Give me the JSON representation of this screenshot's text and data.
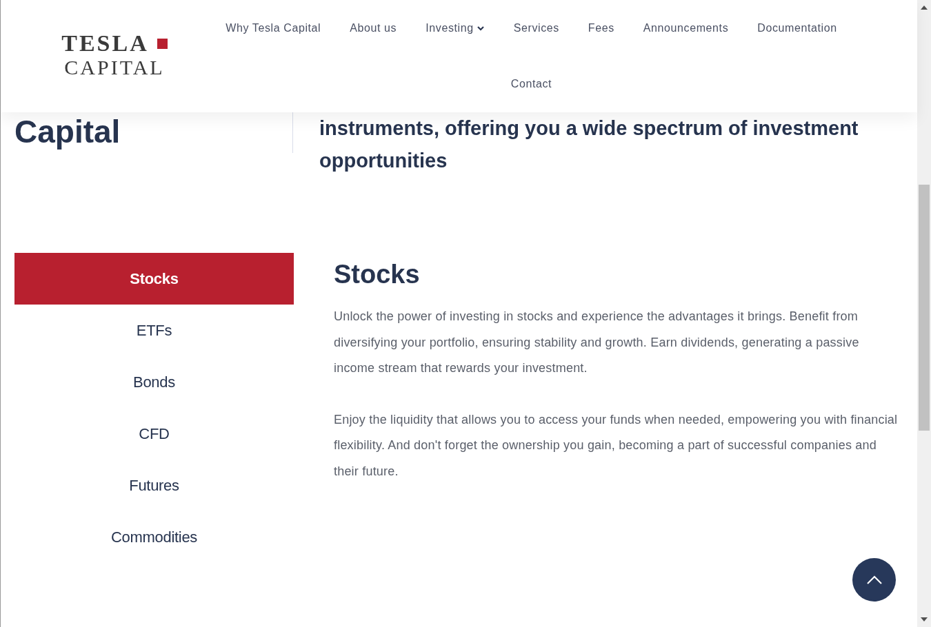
{
  "header": {
    "logo": {
      "line_1": "TESLA",
      "line_2": "CAPITAL"
    },
    "nav": [
      {
        "label": "Why Tesla Capital",
        "dropdown": false
      },
      {
        "label": "About us",
        "dropdown": false
      },
      {
        "label": "Investing",
        "dropdown": true
      },
      {
        "label": "Services",
        "dropdown": false
      },
      {
        "label": "Fees",
        "dropdown": false
      },
      {
        "label": "Announcements",
        "dropdown": false
      },
      {
        "label": "Documentation",
        "dropdown": false
      },
      {
        "label": "Contact",
        "dropdown": false
      }
    ]
  },
  "hero": {
    "title": "Capital",
    "subtitle": "instruments, offering you a wide spectrum of investment opportunities"
  },
  "tabs": [
    {
      "label": "Stocks",
      "selected": true
    },
    {
      "label": "ETFs",
      "selected": false
    },
    {
      "label": "Bonds",
      "selected": false
    },
    {
      "label": "CFD",
      "selected": false
    },
    {
      "label": "Futures",
      "selected": false
    },
    {
      "label": "Commodities",
      "selected": false
    }
  ],
  "content": {
    "heading": "Stocks",
    "paragraphs": [
      "Unlock the power of investing in stocks and experience the advantages it brings. Benefit from diversifying your portfolio, ensuring stability and growth. Earn dividends, generating a passive income stream that rewards your investment.",
      "Enjoy the liquidity that allows you to access your funds when needed, empowering you with financial flexibility. And don't forget the ownership you gain, becoming a part of successful companies and their future."
    ]
  }
}
